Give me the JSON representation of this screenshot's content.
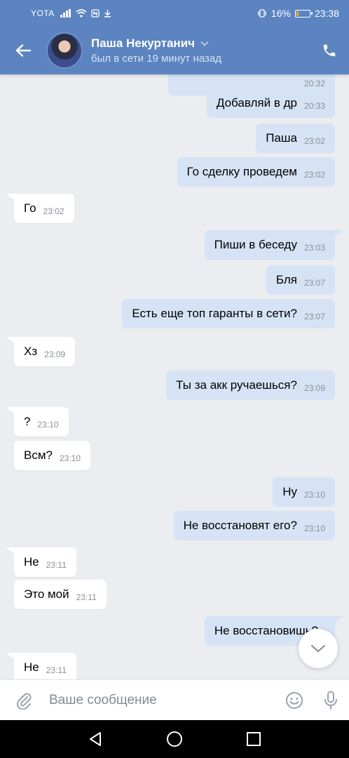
{
  "status_bar": {
    "carrier": "YOTA",
    "battery": "16%",
    "battery_level": 0.16,
    "time": "23:38"
  },
  "header": {
    "name": "Паша Некуртанич",
    "status": "был в сети 19 минут назад",
    "icons": [
      "back-arrow-icon",
      "chevron-down-icon",
      "phone-icon"
    ]
  },
  "messages": [
    {
      "dir": "out",
      "text": "",
      "time": "20:32",
      "partial": true
    },
    {
      "dir": "out",
      "text": "Добавляй в др",
      "time": "20:33"
    },
    {
      "dir": "out",
      "text": "Паша",
      "time": "23:02"
    },
    {
      "dir": "out",
      "text": "Го сделку проведем",
      "time": "23:02"
    },
    {
      "dir": "in",
      "text": "Го",
      "time": "23:02"
    },
    {
      "dir": "out",
      "text": "Пиши в беседу",
      "time": "23:03"
    },
    {
      "dir": "out",
      "text": "Бля",
      "time": "23:07"
    },
    {
      "dir": "out",
      "text": "Есть еще топ гаранты в сети?",
      "time": "23:07"
    },
    {
      "dir": "in",
      "text": "Хз",
      "time": "23:09"
    },
    {
      "dir": "out",
      "text": "Ты за акк ручаешься?",
      "time": "23:09"
    },
    {
      "dir": "in",
      "text": "?",
      "time": "23:10"
    },
    {
      "dir": "in",
      "text": "Всм?",
      "time": "23:10"
    },
    {
      "dir": "out",
      "text": "Ну",
      "time": "23:10"
    },
    {
      "dir": "out",
      "text": "Не восстановят его?",
      "time": "23:10"
    },
    {
      "dir": "in",
      "text": "Не",
      "time": "23:11"
    },
    {
      "dir": "in",
      "text": "Это мой",
      "time": "23:11"
    },
    {
      "dir": "out",
      "text": "Не восстановишь?",
      "time": ""
    },
    {
      "dir": "in",
      "text": "Не",
      "time": "23:11"
    }
  ],
  "composer": {
    "placeholder": "Ваше сообщение",
    "icons": [
      "paperclip-icon",
      "emoji-icon",
      "microphone-icon"
    ]
  },
  "nav_bar": {
    "icons": [
      "nav-back-icon",
      "nav-home-icon",
      "nav-recents-icon"
    ]
  },
  "colors": {
    "header": "#5b84c0",
    "outgoing_bubble": "#d5e3f5",
    "incoming_bubble": "#ffffff",
    "chat_background": "#ebedf0"
  }
}
